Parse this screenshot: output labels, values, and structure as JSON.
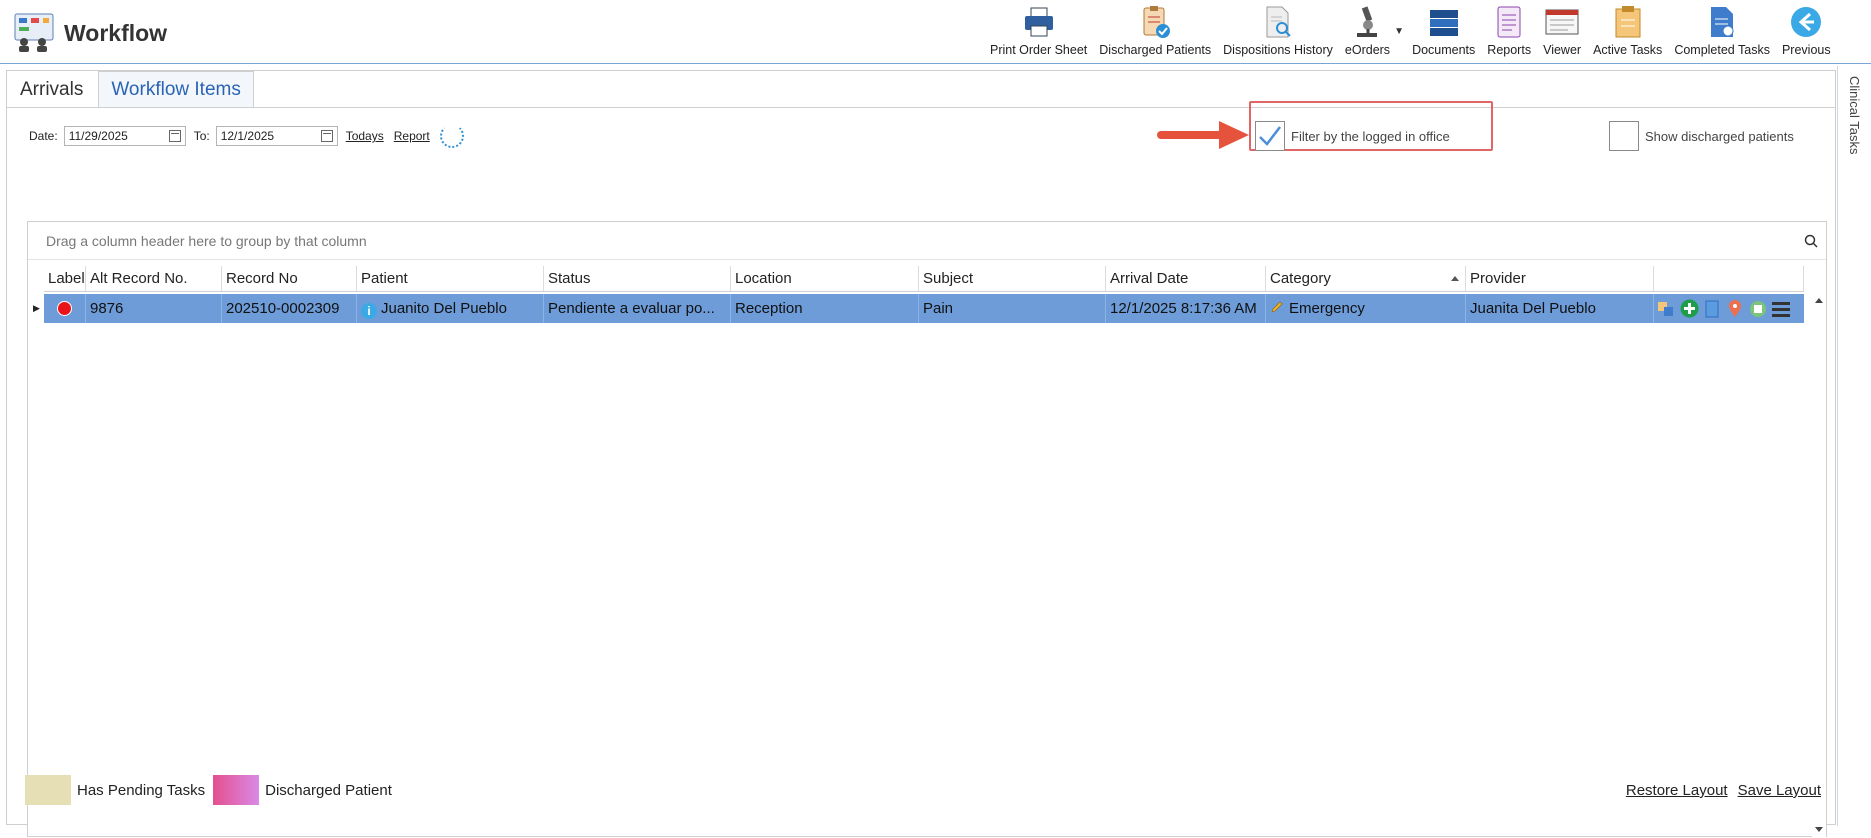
{
  "header": {
    "title": "Workflow",
    "toolbar": [
      {
        "id": "print",
        "label": "Print Order Sheet"
      },
      {
        "id": "discharged",
        "label": "Discharged Patients"
      },
      {
        "id": "dispositions",
        "label": "Dispositions History"
      },
      {
        "id": "eorders",
        "label": "eOrders"
      },
      {
        "id": "documents",
        "label": "Documents"
      },
      {
        "id": "reports",
        "label": "Reports"
      },
      {
        "id": "viewer",
        "label": "Viewer"
      },
      {
        "id": "active",
        "label": "Active Tasks"
      },
      {
        "id": "completed",
        "label": "Completed Tasks"
      },
      {
        "id": "previous",
        "label": "Previous"
      }
    ]
  },
  "side_tab": {
    "label": "Clinical Tasks"
  },
  "tabs": [
    {
      "label": "Arrivals",
      "active": true
    },
    {
      "label": "Workflow Items",
      "active": false
    }
  ],
  "filters": {
    "date_label": "Date:",
    "date_from": "11/29/2025",
    "to_label": "To:",
    "date_to": "12/1/2025",
    "todays_link": "Todays",
    "report_link": "Report",
    "filter_office_label": "Filter by the logged in office",
    "filter_office_checked": true,
    "show_discharged_label": "Show discharged patients",
    "show_discharged_checked": false
  },
  "grid": {
    "group_placeholder": "Drag a column header here to group by that column",
    "columns": [
      "Label",
      "Alt Record No.",
      "Record No",
      "Patient",
      "Status",
      "Location",
      "Subject",
      "Arrival Date",
      "Category",
      "Provider",
      ""
    ],
    "sorted_column": "Category",
    "rows": [
      {
        "alt_record": "9876",
        "record_no": "202510-0002309",
        "patient": "Juanito Del Pueblo",
        "status": "Pendiente a evaluar po...",
        "location": "Reception",
        "subject": "Pain",
        "arrival_date": "12/1/2025 8:17:36 AM",
        "category": "Emergency",
        "provider": "Juanita Del Pueblo"
      }
    ]
  },
  "legend": [
    {
      "label": "Has Pending Tasks",
      "color": "#e6dfb5"
    },
    {
      "label": "Discharged Patient",
      "color": "#e44f8f"
    }
  ],
  "footer": {
    "restore": "Restore Layout",
    "save": "Save Layout"
  },
  "colors": {
    "selected_row": "#6d9cd8",
    "accent": "#2a63b5",
    "highlight": "#e06666"
  }
}
